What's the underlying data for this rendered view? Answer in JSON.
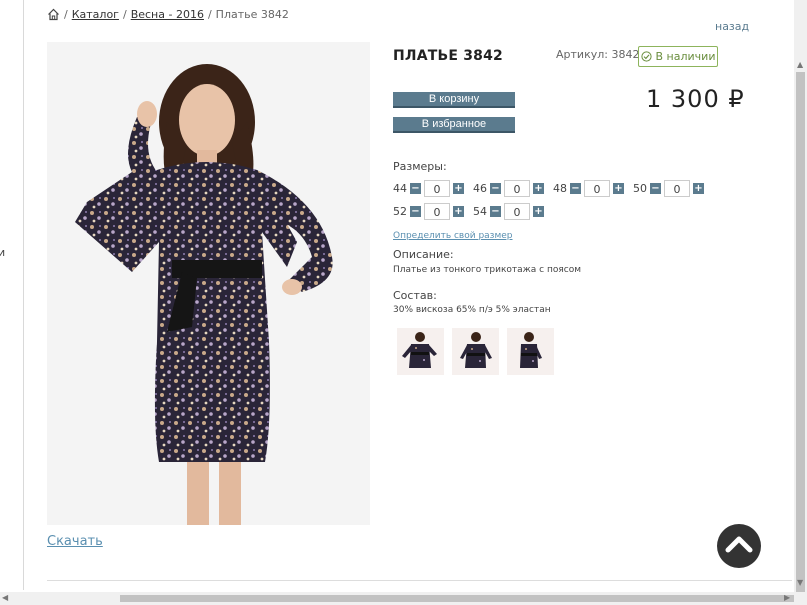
{
  "left_rail": {
    "fragment": "и"
  },
  "breadcrumb": {
    "items": [
      "Каталог",
      "Весна - 2016"
    ],
    "current": "Платье 3842",
    "separator": "/"
  },
  "back_link": "назад",
  "product": {
    "title": "ПЛАТЬЕ 3842",
    "sku": "Артикул: 3842",
    "stock": "В наличии",
    "price": "1 300 ₽"
  },
  "buttons": {
    "cart": "В корзину",
    "favorite": "В избранное"
  },
  "sizes": {
    "label": "Размеры:",
    "row1": [
      {
        "size": "44",
        "qty": "0"
      },
      {
        "size": "46",
        "qty": "0"
      },
      {
        "size": "48",
        "qty": "0"
      },
      {
        "size": "50",
        "qty": "0"
      }
    ],
    "row2": [
      {
        "size": "52",
        "qty": "0"
      },
      {
        "size": "54",
        "qty": "0"
      }
    ],
    "determine_link": "Определить свой размер"
  },
  "description": {
    "label": "Описание:",
    "text": "Платье из тонкого трикотажа с поясом"
  },
  "composition": {
    "label": "Состав:",
    "text": "30% вискоза 65% п/э 5% эластан"
  },
  "download": "Скачать",
  "colors": {
    "accent": "#5b7b8e",
    "stock_green": "#8db45c",
    "link": "#5a8fb0"
  }
}
